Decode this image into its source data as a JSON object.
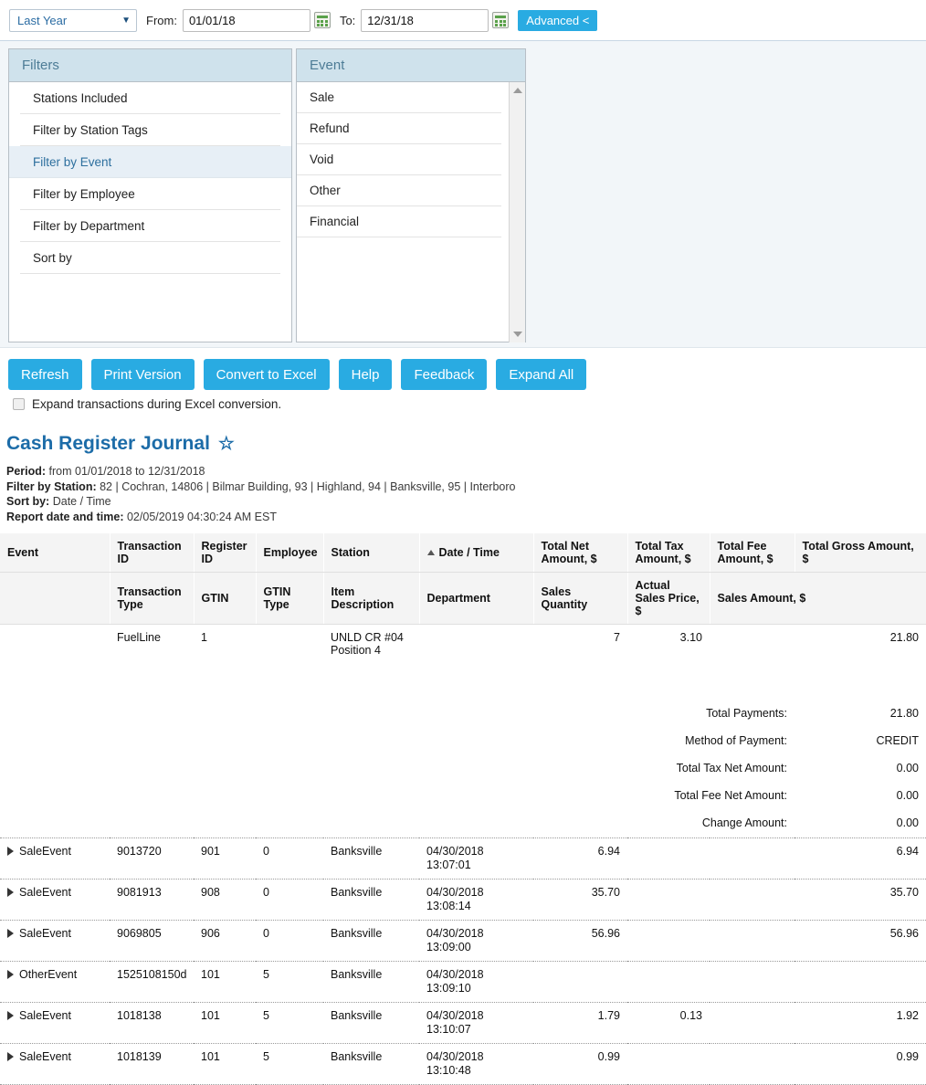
{
  "toolbar": {
    "period_value": "Last Year",
    "caret": "▼",
    "from_label": "From:",
    "from_value": "01/01/18",
    "to_label": "To:",
    "to_value": "12/31/18",
    "advanced_label": "Advanced <"
  },
  "filters_panel": {
    "title": "Filters",
    "items": [
      {
        "label": "Stations Included",
        "active": false
      },
      {
        "label": "Filter by Station Tags",
        "active": false
      },
      {
        "label": "Filter by Event",
        "active": true
      },
      {
        "label": "Filter by Employee",
        "active": false
      },
      {
        "label": "Filter by Department",
        "active": false
      },
      {
        "label": "Sort by",
        "active": false
      }
    ]
  },
  "event_panel": {
    "title": "Event",
    "items": [
      "Sale",
      "Refund",
      "Void",
      "Other",
      "Financial"
    ]
  },
  "actions": {
    "buttons": [
      "Refresh",
      "Print Version",
      "Convert to Excel",
      "Help",
      "Feedback",
      "Expand All"
    ],
    "checkbox_label": "Expand transactions during Excel conversion.",
    "checkbox_checked": false
  },
  "report": {
    "title": "Cash Register Journal",
    "star_glyph": "☆",
    "period_label": "Period:",
    "period_value": "from 01/01/2018 to 12/31/2018",
    "station_label": "Filter by Station:",
    "station_value": "82 | Cochran, 14806 | Bilmar Building, 93 | Highland, 94 | Banksville, 95 | Interboro",
    "sortby_label": "Sort by:",
    "sortby_value": "Date / Time",
    "reportdate_label": "Report date and time:",
    "reportdate_value": "02/05/2019 04:30:24 AM EST"
  },
  "table": {
    "headers_main": [
      "Event",
      "Transaction ID",
      "Register ID",
      "Employee",
      "Station",
      "Date / Time",
      "Total Net Amount, $",
      "Total Tax Amount, $",
      "Total Fee Amount, $",
      "Total Gross Amount, $"
    ],
    "sort_column": "Date / Time",
    "sort_direction": "asc",
    "headers_sub": [
      "",
      "Transaction Type",
      "GTIN",
      "GTIN Type",
      "Item Description",
      "Department",
      "Sales Quantity",
      "Actual Sales Price, $",
      "Sales Amount, $"
    ],
    "detail_row": {
      "transaction_type": "FuelLine",
      "gtin": "1",
      "gtin_type": "",
      "item_description": "UNLD CR #04 Position 4",
      "item_description_line1": "UNLD CR #04",
      "item_description_line2": "Position 4",
      "department": "",
      "sales_quantity": "7",
      "actual_sales_price": "3.10",
      "sales_amount": "21.80"
    },
    "summary": [
      {
        "label": "Total Payments:",
        "value": "21.80"
      },
      {
        "label": "Method of Payment:",
        "value": "CREDIT"
      },
      {
        "label": "Total Tax Net Amount:",
        "value": "0.00"
      },
      {
        "label": "Total Fee Net Amount:",
        "value": "0.00"
      },
      {
        "label": "Change Amount:",
        "value": "0.00"
      }
    ],
    "rows": [
      {
        "event": "SaleEvent",
        "transaction_id": "9013720",
        "register_id": "901",
        "employee": "0",
        "station": "Banksville",
        "date": "04/30/2018",
        "time": "13:07:01",
        "total_net": "6.94",
        "total_tax": "",
        "total_fee": "",
        "total_gross": "6.94"
      },
      {
        "event": "SaleEvent",
        "transaction_id": "9081913",
        "register_id": "908",
        "employee": "0",
        "station": "Banksville",
        "date": "04/30/2018",
        "time": "13:08:14",
        "total_net": "35.70",
        "total_tax": "",
        "total_fee": "",
        "total_gross": "35.70"
      },
      {
        "event": "SaleEvent",
        "transaction_id": "9069805",
        "register_id": "906",
        "employee": "0",
        "station": "Banksville",
        "date": "04/30/2018",
        "time": "13:09:00",
        "total_net": "56.96",
        "total_tax": "",
        "total_fee": "",
        "total_gross": "56.96"
      },
      {
        "event": "OtherEvent",
        "transaction_id": "1525108150d",
        "register_id": "101",
        "employee": "5",
        "station": "Banksville",
        "date": "04/30/2018",
        "time": "13:09:10",
        "total_net": "",
        "total_tax": "",
        "total_fee": "",
        "total_gross": ""
      },
      {
        "event": "SaleEvent",
        "transaction_id": "1018138",
        "register_id": "101",
        "employee": "5",
        "station": "Banksville",
        "date": "04/30/2018",
        "time": "13:10:07",
        "total_net": "1.79",
        "total_tax": "0.13",
        "total_fee": "",
        "total_gross": "1.92"
      },
      {
        "event": "SaleEvent",
        "transaction_id": "1018139",
        "register_id": "101",
        "employee": "5",
        "station": "Banksville",
        "date": "04/30/2018",
        "time": "13:10:48",
        "total_net": "0.99",
        "total_tax": "",
        "total_fee": "",
        "total_gross": "0.99"
      }
    ]
  },
  "colors": {
    "accent_blue": "#29abe2",
    "title_blue": "#1c6ca8",
    "panel_head": "#cfe2ec",
    "filter_active_bg": "#e7eff6",
    "calendar_green": "#5aa14a"
  }
}
